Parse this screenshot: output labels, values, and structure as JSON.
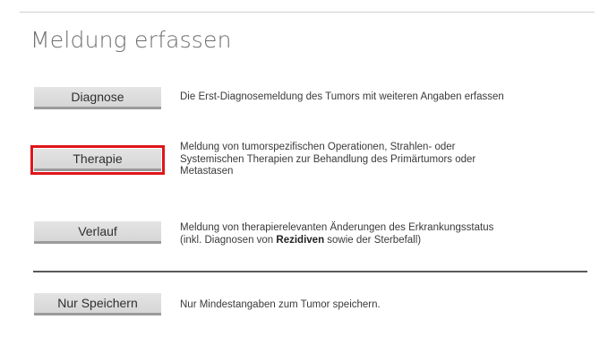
{
  "title": "Meldung erfassen",
  "options": [
    {
      "id": "diagnose",
      "button_label": "Diagnose",
      "description": "Die Erst-Diagnosemeldung des Tumors mit weiteren Angaben erfassen",
      "highlighted": false
    },
    {
      "id": "therapie",
      "button_label": "Therapie",
      "description_line1": "Meldung von tumorspezifischen Operationen, Strahlen- oder",
      "description_line2": "Systemischen Therapien zur Behandlung des Primärtumors oder",
      "description_line3": "Metastasen",
      "highlighted": true
    },
    {
      "id": "verlauf",
      "button_label": "Verlauf",
      "description_line1": "Meldung von therapierelevanten Änderungen des Erkrankungsstatus",
      "description_line2_pre": "(inkl. Diagnosen von ",
      "description_line2_bold": "Rezidiven",
      "description_line2_post": " sowie der Sterbefall)",
      "highlighted": false
    },
    {
      "id": "nur-speichern",
      "button_label": "Nur Speichern",
      "description": "Nur Mindestangaben zum Tumor speichern.",
      "highlighted": false
    }
  ],
  "colors": {
    "highlight_border": "#e0151b",
    "button_bg": "#dcdcdc",
    "button_border": "#9b9b9b",
    "title_text": "#6f6f6f",
    "divider": "#5a5a5a"
  }
}
